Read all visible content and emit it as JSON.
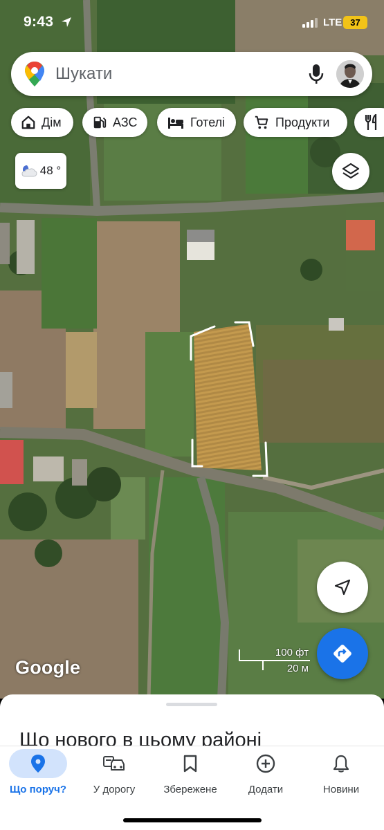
{
  "status_bar": {
    "time": "9:43",
    "network": "LTE",
    "battery": "37"
  },
  "search": {
    "placeholder": "Шукати",
    "left_icon": "google-maps-pin-icon",
    "mic_icon": "mic-icon",
    "avatar": "user-avatar"
  },
  "chips": [
    {
      "label": "Дім",
      "icon": "home-icon"
    },
    {
      "label": "АЗС",
      "icon": "gas-station-icon"
    },
    {
      "label": "Готелі",
      "icon": "bed-icon"
    },
    {
      "label": "Продукти",
      "icon": "cart-icon"
    },
    {
      "label": "",
      "icon": "restaurant-icon"
    }
  ],
  "weather": {
    "temp": "48 °",
    "icon": "partly-cloudy-icon"
  },
  "map": {
    "logo": "Google",
    "scale_ft": "100 фт",
    "scale_m": "20 м",
    "selection_color": "#ffffff"
  },
  "sheet": {
    "title": "Що нового в цьому районі"
  },
  "nav": {
    "items": [
      {
        "label": "Що поруч?",
        "icon": "explore-pin-icon",
        "active": true
      },
      {
        "label": "У дорогу",
        "icon": "car-icon",
        "active": false
      },
      {
        "label": "Збережене",
        "icon": "bookmark-icon",
        "active": false
      },
      {
        "label": "Додати",
        "icon": "add-circle-icon",
        "active": false
      },
      {
        "label": "Новини",
        "icon": "bell-icon",
        "active": false
      }
    ]
  },
  "colors": {
    "accent": "#1a73e8",
    "active_bg": "#d2e3fc"
  }
}
